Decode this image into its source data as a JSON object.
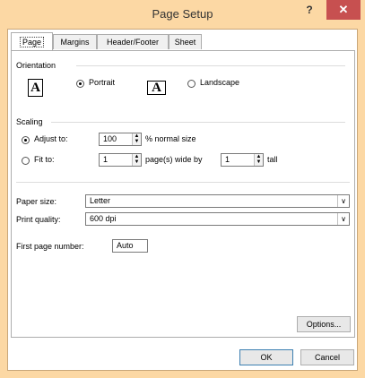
{
  "window": {
    "title": "Page Setup",
    "help_label": "?",
    "close_label": "✕"
  },
  "tabs": [
    {
      "label": "Page"
    },
    {
      "label": "Margins"
    },
    {
      "label": "Header/Footer"
    },
    {
      "label": "Sheet"
    }
  ],
  "orientation": {
    "title": "Orientation",
    "portrait_label": "Portrait",
    "landscape_label": "Landscape",
    "selected": "Portrait",
    "icon_glyph": "A"
  },
  "scaling": {
    "title": "Scaling",
    "adjust_label": "Adjust to:",
    "adjust_value": "100",
    "adjust_suffix": "% normal size",
    "fit_label": "Fit to:",
    "fit_wide_value": "1",
    "fit_wide_suffix": "page(s) wide by",
    "fit_tall_value": "1",
    "fit_tall_suffix": "tall",
    "selected": "Adjust to:"
  },
  "paper": {
    "size_label": "Paper size:",
    "size_value": "Letter",
    "quality_label": "Print quality:",
    "quality_value": "600 dpi"
  },
  "first_page": {
    "label": "First page number:",
    "value": "Auto"
  },
  "buttons": {
    "options": "Options...",
    "ok": "OK",
    "cancel": "Cancel"
  },
  "icons": {
    "close": "close-icon",
    "help": "help-icon",
    "dropdown": "chevron-down-icon",
    "spin": "spinner-arrows-icon"
  },
  "colors": {
    "titlebar": "#fcd8a4",
    "close_button": "#c75050"
  }
}
